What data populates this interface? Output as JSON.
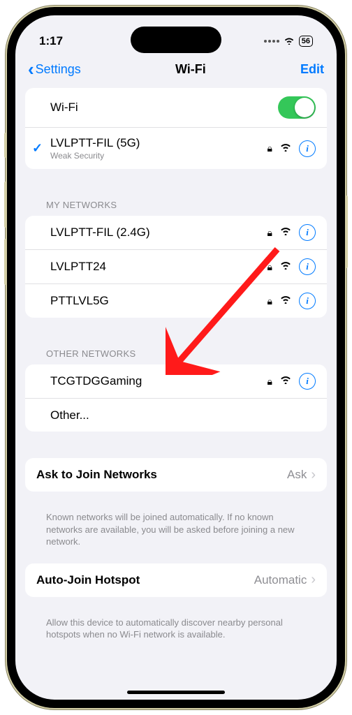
{
  "status": {
    "time": "1:17",
    "battery": "56"
  },
  "nav": {
    "back": "Settings",
    "title": "Wi-Fi",
    "edit": "Edit"
  },
  "wifi": {
    "label": "Wi-Fi",
    "connected": {
      "name": "LVLPTT-FIL (5G)",
      "sub": "Weak Security"
    }
  },
  "my_networks": {
    "header": "MY NETWORKS",
    "items": [
      {
        "name": "LVLPTT-FIL (2.4G)"
      },
      {
        "name": "LVLPTT24"
      },
      {
        "name": "PTTLVL5G"
      }
    ]
  },
  "other_networks": {
    "header": "OTHER NETWORKS",
    "items": [
      {
        "name": "TCGTDGGaming"
      }
    ],
    "other": "Other..."
  },
  "ask_join": {
    "label": "Ask to Join Networks",
    "value": "Ask",
    "footer": "Known networks will be joined automatically. If no known networks are available, you will be asked before joining a new network."
  },
  "auto_hotspot": {
    "label": "Auto-Join Hotspot",
    "value": "Automatic",
    "footer": "Allow this device to automatically discover nearby personal hotspots when no Wi-Fi network is available."
  }
}
